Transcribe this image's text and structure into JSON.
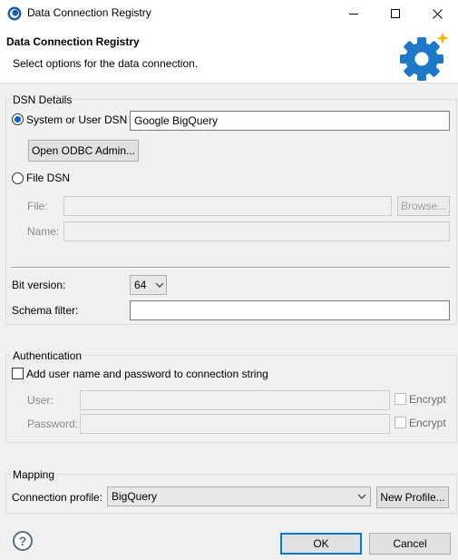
{
  "window": {
    "title": "Data Connection Registry"
  },
  "header": {
    "title": "Data Connection Registry",
    "description": "Select options for the data connection."
  },
  "dsn": {
    "group_label": "DSN Details",
    "system_user_label": "System or User DSN",
    "system_user_selected": true,
    "system_user_value": "Google BigQuery",
    "odbc_button": "Open ODBC Admin...",
    "file_dsn_label": "File DSN",
    "file_label": "File:",
    "file_value": "",
    "browse_button": "Browse...",
    "name_label": "Name:",
    "name_value": "",
    "bit_version_label": "Bit version:",
    "bit_version_value": "64",
    "schema_filter_label": "Schema filter:",
    "schema_filter_value": ""
  },
  "auth": {
    "group_label": "Authentication",
    "add_credentials_label": "Add user name and password to connection string",
    "add_credentials_checked": false,
    "user_label": "User:",
    "password_label": "Password:",
    "encrypt_label": "Encrypt"
  },
  "mapping": {
    "group_label": "Mapping",
    "profile_label": "Connection profile:",
    "profile_value": "BigQuery",
    "new_profile_button": "New Profile..."
  },
  "footer": {
    "help_glyph": "?",
    "ok_button": "OK",
    "cancel_button": "Cancel"
  },
  "icons": {
    "app": "app-logo-icon",
    "gear": "gear-icon",
    "help": "help-icon"
  },
  "colors": {
    "accent": "#0078d7",
    "gear": "#1e78c8",
    "spark": "#f0b400"
  }
}
